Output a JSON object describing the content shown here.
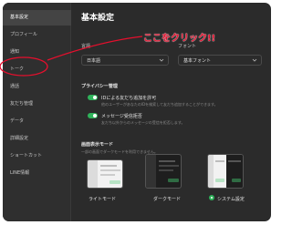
{
  "sidebar": {
    "items": [
      {
        "label": "基本設定"
      },
      {
        "label": "プロフィール"
      },
      {
        "label": "通知"
      },
      {
        "label": "トーク"
      },
      {
        "label": "通話"
      },
      {
        "label": "友だち管理"
      },
      {
        "label": "データ"
      },
      {
        "label": "詳細設定"
      },
      {
        "label": "ショートカット"
      },
      {
        "label": "LINE情報"
      }
    ],
    "active_index": 0
  },
  "main": {
    "title": "基本設定",
    "language": {
      "label": "言語",
      "value": "日本語"
    },
    "font": {
      "label": "フォント",
      "value": "基本フォント"
    },
    "privacy": {
      "title": "プライバシー管理",
      "options": [
        {
          "label": "IDによる友だち追加を許可",
          "desc": "他のユーザーがあなたのIDを検索して友だち追加することができます。",
          "on": true
        },
        {
          "label": "メッセージ受信拒否",
          "desc": "友だち以外からのメッセージの受信を拒否します。",
          "on": true
        }
      ]
    },
    "display_mode": {
      "title": "画面表示モード",
      "desc": "一部の画面でダークモードを利用できません。",
      "modes": [
        {
          "label": "ライトモード"
        },
        {
          "label": "ダークモード"
        },
        {
          "label": "システム設定"
        }
      ],
      "selected_index": 2
    }
  },
  "annotation": {
    "text": "ここをクリック!!",
    "color": "#e60f2d"
  },
  "colors": {
    "accent": "#2fb35a",
    "sidebar_active": "#444444",
    "background": "#2b2b2b"
  }
}
